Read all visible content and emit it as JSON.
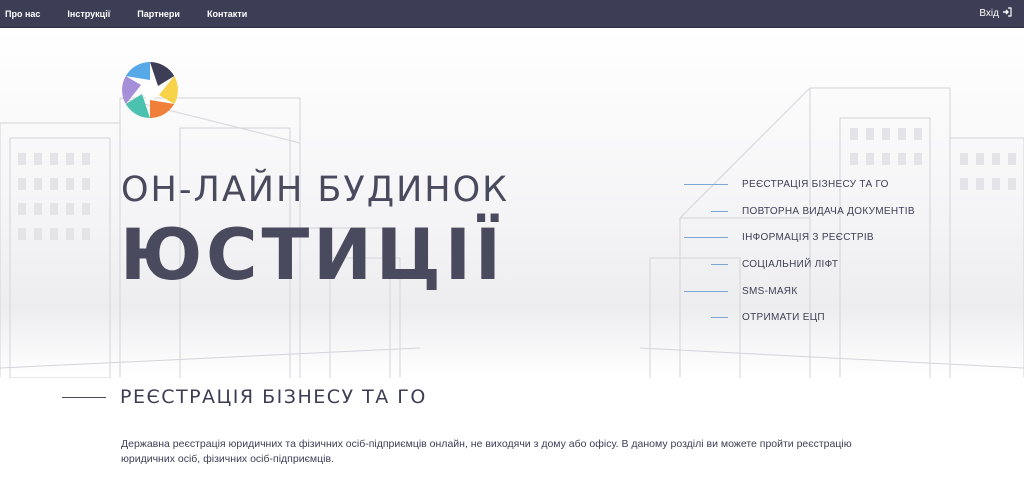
{
  "nav": {
    "items": [
      "Про нас",
      "Інструкції",
      "Партнери",
      "Контакти"
    ],
    "login_label": "Вхід",
    "login_icon": "sign-in-icon"
  },
  "hero": {
    "title_line1": "ОН-ЛАЙН БУДИНОК",
    "title_line2": "ЮСТИЦІЇ",
    "logo_icon": "camera-aperture-logo",
    "logo_colors": [
      "#3d3e55",
      "#f7d34a",
      "#f07f3a",
      "#4cc1b0",
      "#a48fd8",
      "#56a8e6"
    ]
  },
  "menu": {
    "items": [
      "РЕЄСТРАЦІЯ БІЗНЕСУ ТА ГО",
      "ПОВТОРНА ВИДАЧА ДОКУМЕНТІВ",
      "ІНФОРМАЦІЯ З РЕЄСТРІВ",
      "СОЦІАЛЬНИЙ ЛІФТ",
      "SMS-МАЯК",
      "ОТРИМАТИ ЕЦП"
    ],
    "line_color": "#7da8d6"
  },
  "section": {
    "title": "РЕЄСТРАЦІЯ БІЗНЕСУ ТА ГО",
    "description": "Державна реєстрація юридичних та фізичних осіб-підприємців онлайн, не виходячи з дому або офісу. В даному розділі ви можете пройти реєстрацію юридичних осіб, фізичних осіб-підприємців."
  },
  "colors": {
    "topbar": "#3d3e55",
    "text_dark": "#4a4a5e"
  }
}
